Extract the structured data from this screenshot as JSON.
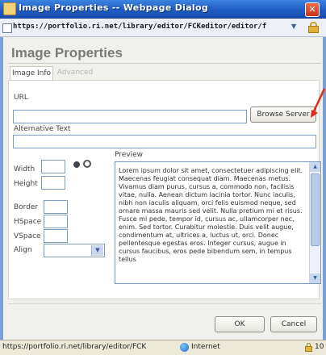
{
  "window": {
    "title": "Image Properties -- Webpage Dialog",
    "close_glyph": "✕",
    "address_url": "https://portfolio.ri.net/library/editor/FCKeditor/editor/f",
    "address_chevron": "▼"
  },
  "dialog": {
    "heading": "Image Properties",
    "tabs": [
      {
        "label": "Image Info",
        "selected": true
      },
      {
        "label": "Advanced",
        "selected": false
      }
    ],
    "url_label": "URL",
    "url_value": "",
    "browse_button": "Browse Server",
    "alt_label": "Alternative Text",
    "alt_value": "",
    "width_label": "Width",
    "height_label": "Height",
    "border_label": "Border",
    "hspace_label": "HSpace",
    "vspace_label": "VSpace",
    "align_label": "Align",
    "align_value": "",
    "select_arrow": "▼",
    "preview_label": "Preview",
    "preview_text": "Lorem ipsum dolor sit amet, consectetuer adipiscing elit. Maecenas feugiat consequat diam. Maecenas metus. Vivamus diam purus, cursus a, commodo non, facilisis vitae, nulla. Aenean dictum lacinia tortor. Nunc iaculis, nibh non iaculis aliquam, orci felis euismod neque, sed ornare massa mauris sed velit. Nulla pretium mi et risus. Fusce mi pede, tempor id, cursus ac, ullamcorper nec, enim. Sed tortor. Curabitur molestie. Duis velit augue, condimentum at, ultrices a, luctus ut, orci. Donec pellentesque egestas eros. Integer cursus, augue in cursus faucibus, eros pede bibendum sem, in tempus tellus",
    "scroll_up": "▲",
    "scroll_down": "▼",
    "ok_button": "OK",
    "cancel_button": "Cancel"
  },
  "statusbar": {
    "url": "https://portfolio.ri.net/library/editor/FCK",
    "zone": "Internet",
    "zoom": "10"
  },
  "icons": {
    "app": "dialog-app-icon",
    "close": "close-icon",
    "lock": "padlock-icon",
    "globe": "globe-icon",
    "annotation": "red-arrow"
  },
  "colors": {
    "title_bar": "#1f5bc4",
    "dialog_bg": "#f0f0ec",
    "field_border": "#7f9db9",
    "annotation_arrow": "#e02a1a"
  }
}
